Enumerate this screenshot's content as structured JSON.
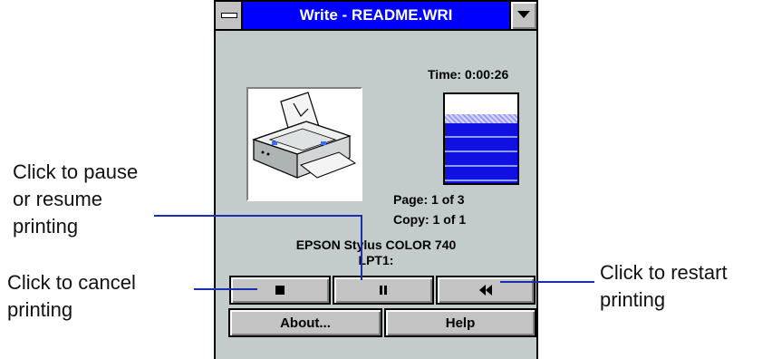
{
  "window": {
    "title": "Write - README.WRI",
    "time_label": "Time: 0:00:26",
    "progress_fraction": 0.67,
    "page_label": "Page: 1 of 3",
    "copy_label": "Copy: 1 of 1",
    "printer_name": "EPSON Stylus COLOR 740",
    "port": "LPT1:",
    "buttons": {
      "cancel_icon": "stop-icon",
      "pause_icon": "pause-icon",
      "restart_icon": "rewind-icon",
      "about_label": "About...",
      "help_label": "Help"
    }
  },
  "callouts": {
    "pause_lines": [
      "Click to pause",
      "or resume",
      "printing"
    ],
    "cancel_lines": [
      "Click to cancel",
      "printing"
    ],
    "restart_lines": [
      "Click to restart",
      "printing"
    ]
  },
  "colors": {
    "title_bar": "#0000ff",
    "window_bg": "#c3cbcb",
    "progress_fill": "#1010e0",
    "callout_line": "#1a2fb0"
  }
}
